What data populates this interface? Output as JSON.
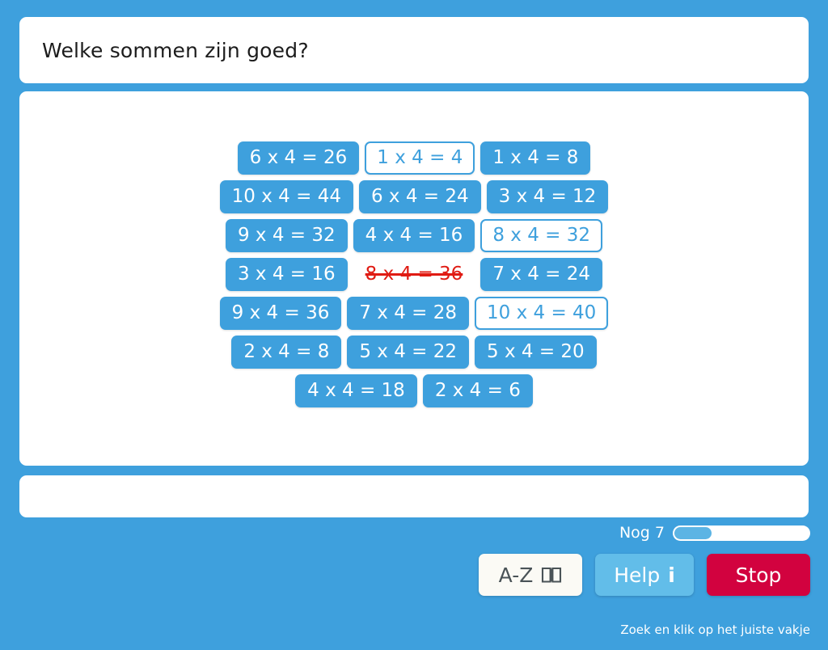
{
  "question": {
    "text": "Welke sommen zijn goed?"
  },
  "grid": {
    "rows": [
      [
        {
          "label": "6 x 4 = 26",
          "state": "default"
        },
        {
          "label": "1 x 4 = 4",
          "state": "found"
        },
        {
          "label": "1 x 4 = 8",
          "state": "default"
        }
      ],
      [
        {
          "label": "10 x 4 = 44",
          "state": "default"
        },
        {
          "label": "6 x 4 = 24",
          "state": "default"
        },
        {
          "label": "3 x 4 = 12",
          "state": "default"
        }
      ],
      [
        {
          "label": "9 x 4 = 32",
          "state": "default"
        },
        {
          "label": "4 x 4 = 16",
          "state": "default"
        },
        {
          "label": "8 x 4 = 32",
          "state": "found"
        }
      ],
      [
        {
          "label": "3 x 4 = 16",
          "state": "default"
        },
        {
          "label": "8 x 4 = 36",
          "state": "wrong"
        },
        {
          "label": "7 x 4 = 24",
          "state": "default"
        }
      ],
      [
        {
          "label": "9 x 4 = 36",
          "state": "default"
        },
        {
          "label": "7 x 4 = 28",
          "state": "default"
        },
        {
          "label": "10 x 4 = 40",
          "state": "found"
        }
      ],
      [
        {
          "label": "2 x 4 = 8",
          "state": "default"
        },
        {
          "label": "5 x 4 = 22",
          "state": "default"
        },
        {
          "label": "5 x 4 = 20",
          "state": "default"
        }
      ],
      [
        {
          "label": "4 x 4 = 18",
          "state": "default"
        },
        {
          "label": "2 x 4 = 6",
          "state": "default"
        }
      ]
    ]
  },
  "answer_bar": {
    "value": ""
  },
  "progress": {
    "label": "Nog 7",
    "remaining": 7,
    "percent": 28
  },
  "buttons": {
    "az": {
      "label": "A-Z",
      "icon": "open-book-icon"
    },
    "help": {
      "label": "Help",
      "icon": "info-i-icon"
    },
    "stop": {
      "label": "Stop"
    }
  },
  "footer": {
    "hint": "Zoek en klik op het juiste vakje"
  },
  "colors": {
    "background_blue": "#3ea0dd",
    "tile_blue": "#3ea0dd",
    "wrong_red": "#e01b13",
    "stop_red": "#d2023f",
    "help_blue": "#62bde9",
    "az_cream": "#fbfaf5",
    "panel_white": "#ffffff"
  }
}
